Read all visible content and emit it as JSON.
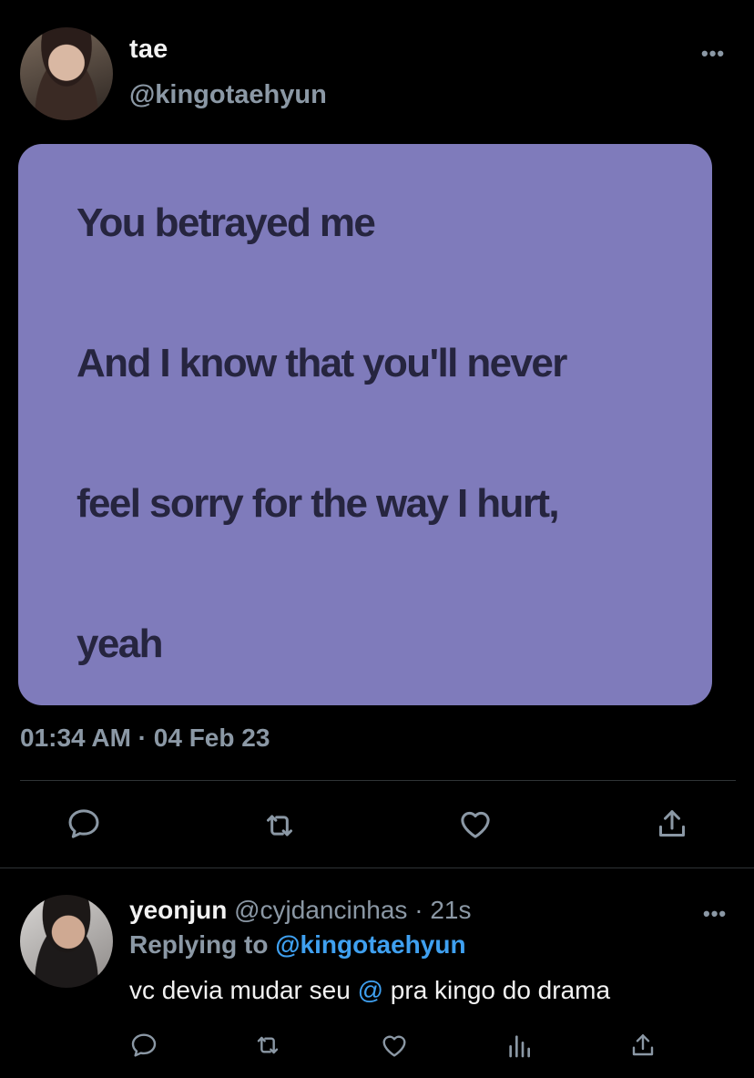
{
  "tweet": {
    "author_name": "tae",
    "author_handle": "@kingotaehyun",
    "more_icon": "•••",
    "card_color": "#7f7bbb",
    "lyrics": [
      "You betrayed me",
      "And I know that you'll never",
      "feel sorry for the way I hurt,",
      "yeah"
    ],
    "timestamp": "01:34 AM · 04 Feb 23",
    "actions": [
      "reply-icon",
      "retweet-icon",
      "like-icon",
      "share-icon"
    ]
  },
  "reply": {
    "name": "yeonjun",
    "handle": "@cyjdancinhas",
    "separator": " · ",
    "time": "21s",
    "more_icon": "•••",
    "replying_label": "Replying to ",
    "replying_handle": "@kingotaehyun",
    "text_before": "vc devia mudar seu ",
    "text_mention": "@",
    "text_after": " pra kingo do drama",
    "actions": [
      "reply-icon",
      "retweet-icon",
      "like-icon",
      "analytics-icon",
      "share-icon"
    ]
  },
  "colors": {
    "background": "#000000",
    "secondary_text": "#8b98a5",
    "link": "#3fa0f0",
    "lyric_text": "#26253f"
  }
}
